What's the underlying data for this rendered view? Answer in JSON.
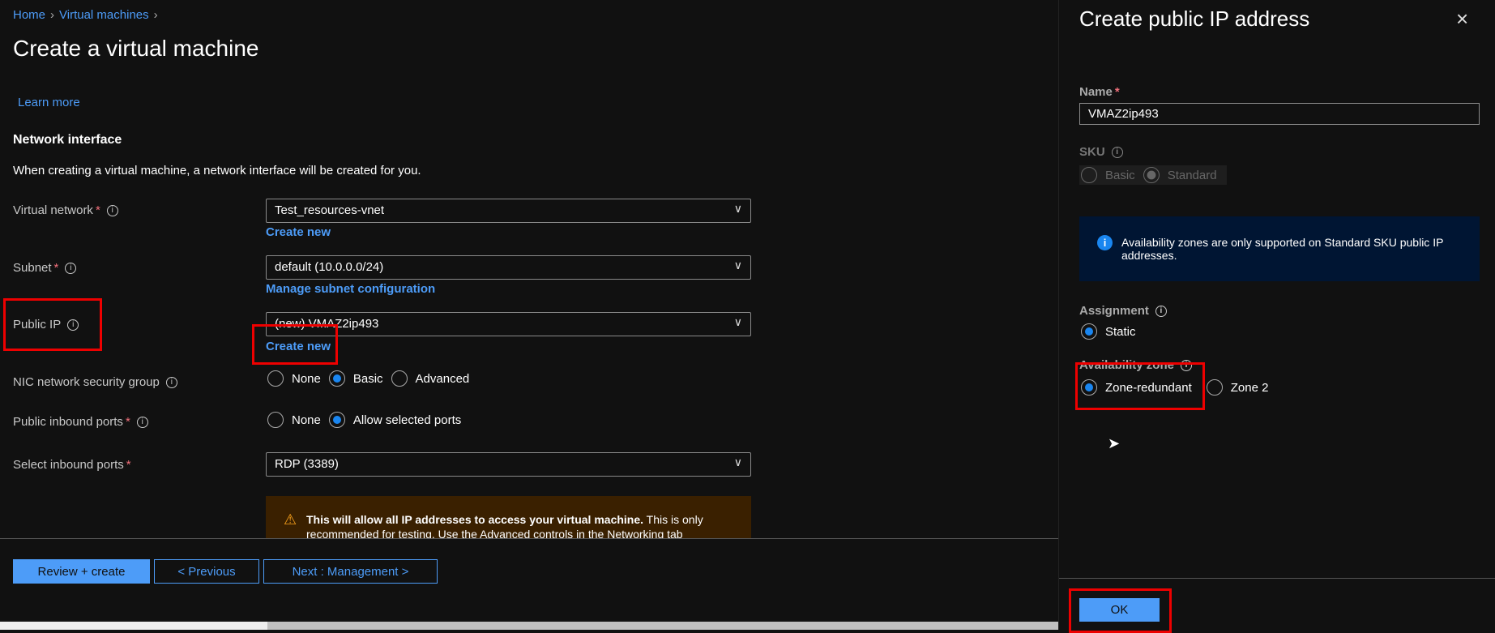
{
  "breadcrumb": {
    "home": "Home",
    "vms": "Virtual machines"
  },
  "page_title": "Create a virtual machine",
  "learn_more": "Learn more",
  "section": {
    "title": "Network interface",
    "desc": "When creating a virtual machine, a network interface will be created for you."
  },
  "fields": {
    "vnet": {
      "label": "Virtual network",
      "value": "Test_resources-vnet",
      "link": "Create new"
    },
    "subnet": {
      "label": "Subnet",
      "value": "default (10.0.0.0/24)",
      "link": "Manage subnet configuration"
    },
    "public_ip": {
      "label": "Public IP",
      "value": "(new) VMAZ2ip493",
      "link": "Create new"
    },
    "nsg": {
      "label": "NIC network security group",
      "options": [
        "None",
        "Basic",
        "Advanced"
      ],
      "selected": "Basic"
    },
    "inbound": {
      "label": "Public inbound ports",
      "options": [
        "None",
        "Allow selected ports"
      ],
      "selected": "Allow selected ports"
    },
    "select_ports": {
      "label": "Select inbound ports",
      "value": "RDP (3389)"
    }
  },
  "warning": {
    "bold": "This will allow all IP addresses to access your virtual machine.",
    "text": "This is only recommended for testing.  Use the Advanced controls in the Networking tab"
  },
  "footer": {
    "review": "Review + create",
    "previous": "< Previous",
    "next": "Next : Management >"
  },
  "panel": {
    "title": "Create public IP address",
    "name_label": "Name",
    "name_value": "VMAZ2ip493",
    "sku_label": "SKU",
    "sku_options": [
      "Basic",
      "Standard"
    ],
    "sku_selected": "Standard",
    "info": "Availability zones are only supported on Standard SKU public IP addresses.",
    "assignment_label": "Assignment",
    "assignment_options": [
      "Static"
    ],
    "az_label": "Availability zone",
    "az_options": [
      "Zone-redundant",
      "Zone 2"
    ],
    "az_selected": "Zone-redundant",
    "ok": "OK"
  },
  "colors": {
    "accent": "#4d9cf8",
    "highlight": "#e00000",
    "warning_bg": "#3a2000",
    "info_bg": "#001533"
  }
}
